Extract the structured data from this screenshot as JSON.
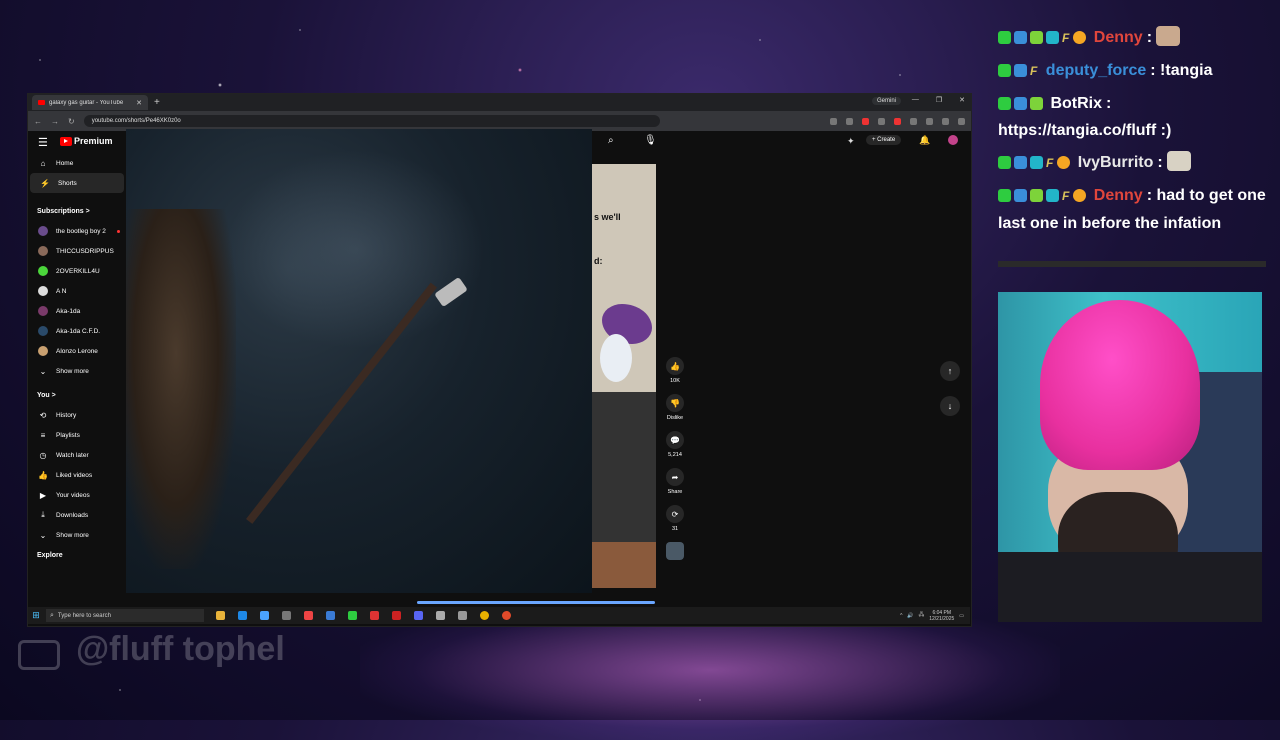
{
  "browser": {
    "tab_title": "galaxy gas guitar - YouTube",
    "gemini_label": "Gemini",
    "url": "youtube.com/shorts/Pe46XK0z0o"
  },
  "youtube": {
    "logo_text": "Premium",
    "create_label": "Create",
    "sidebar": {
      "home": "Home",
      "shorts": "Shorts",
      "subscriptions_heading": "Subscriptions",
      "subscriptions_chevron": ">",
      "subscriptions": [
        "the bootleg boy 2",
        "THICCUSDRIPPUS",
        "2OVERKILL4U",
        "A N",
        "Aka-1da",
        "Aka-1da C.F.D.",
        "Alonzo Lerone"
      ],
      "show_more_1": "Show more",
      "you_heading": "You",
      "you_chevron": ">",
      "you_items": [
        "History",
        "Playlists",
        "Watch later",
        "Liked videos",
        "Your videos",
        "Downloads"
      ],
      "show_more_2": "Show more",
      "explore_heading": "Explore"
    },
    "short_captions": [
      "s we'll",
      "d:"
    ],
    "actions": {
      "like_count": "10K",
      "dislike_label": "Dislike",
      "comment_count": "5,214",
      "share_label": "Share",
      "remix_count": "31"
    }
  },
  "taskbar": {
    "search_placeholder": "Type here to search",
    "time": "6:04 PM",
    "date": "12/21/2025"
  },
  "watermark": "@fluff tophel",
  "chat": [
    {
      "user": "Denny",
      "user_color": "#e0463c",
      "text": ":",
      "emote": "dog"
    },
    {
      "user": "deputy_force",
      "user_color": "#3a8fd9",
      "text": ": !tangia"
    },
    {
      "user": "BotRix",
      "user_color": "#ffffff",
      "text": ": https://tangia.co/fluff :)"
    },
    {
      "user": "IvyBurrito",
      "user_color": "#e8e8e8",
      "text": ":",
      "emote": "cat"
    },
    {
      "user": "Denny",
      "user_color": "#e0463c",
      "text": ": had to get one last one in before the infation"
    }
  ]
}
